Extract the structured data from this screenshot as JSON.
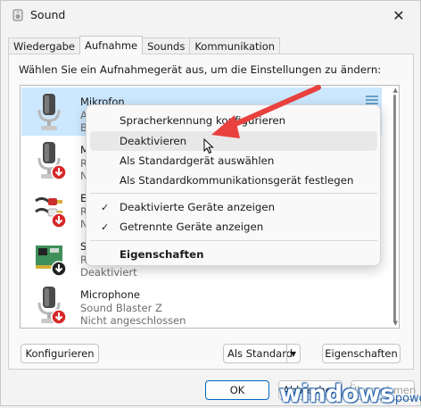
{
  "window": {
    "title": "Sound",
    "close": "✕"
  },
  "tabs": [
    {
      "label": "Wiedergabe",
      "active": false
    },
    {
      "label": "Aufnahme",
      "active": true
    },
    {
      "label": "Sounds",
      "active": false
    },
    {
      "label": "Kommunikation",
      "active": false
    }
  ],
  "instruction": "Wählen Sie ein Aufnahmegerät aus, um die Einstellungen zu ändern:",
  "devices": [
    {
      "name": "Mikrofon",
      "line1": "A",
      "line2": "B",
      "icon": "microphone-icon",
      "selected": true
    },
    {
      "name": "M",
      "line1": "R",
      "line2": "N",
      "icon": "microphone-icon",
      "status": "disconnected"
    },
    {
      "name": "E",
      "line1": "R",
      "line2": "N",
      "icon": "rca-cable-icon",
      "status": "disconnected"
    },
    {
      "name": "S",
      "line1": "R",
      "line2": "Deaktiviert",
      "icon": "sound-card-icon",
      "status": "disabled"
    },
    {
      "name": "Microphone",
      "line1": "Sound Blaster Z",
      "line2": "Nicht angeschlossen",
      "icon": "microphone-icon",
      "status": "disconnected"
    }
  ],
  "context_menu": {
    "items": [
      {
        "label": "Spracherkennung konfigurieren"
      },
      {
        "label": "Deaktivieren",
        "hover": true
      },
      {
        "label": "Als Standardgerät auswählen"
      },
      {
        "label": "Als Standardkommunikationsgerät festlegen"
      },
      {
        "label": "Deaktivierte Geräte anzeigen",
        "checked": true
      },
      {
        "label": "Getrennte Geräte anzeigen",
        "checked": true
      },
      {
        "label": "Eigenschaften",
        "bold": true
      }
    ]
  },
  "buttons": {
    "configure": "Konfigurieren",
    "set_default": "Als Standard",
    "set_default_arrow": "▼",
    "properties": "Eigenschaften",
    "ok": "OK",
    "cancel": "Abbrechen",
    "apply": "Übernehmen"
  },
  "watermark": {
    "main": "windows",
    "sub": "power."
  },
  "colors": {
    "selection": "#cce8ff",
    "accent": "#0067c0",
    "arrow": "#e8413e",
    "watermark": "#1f5fa8"
  }
}
